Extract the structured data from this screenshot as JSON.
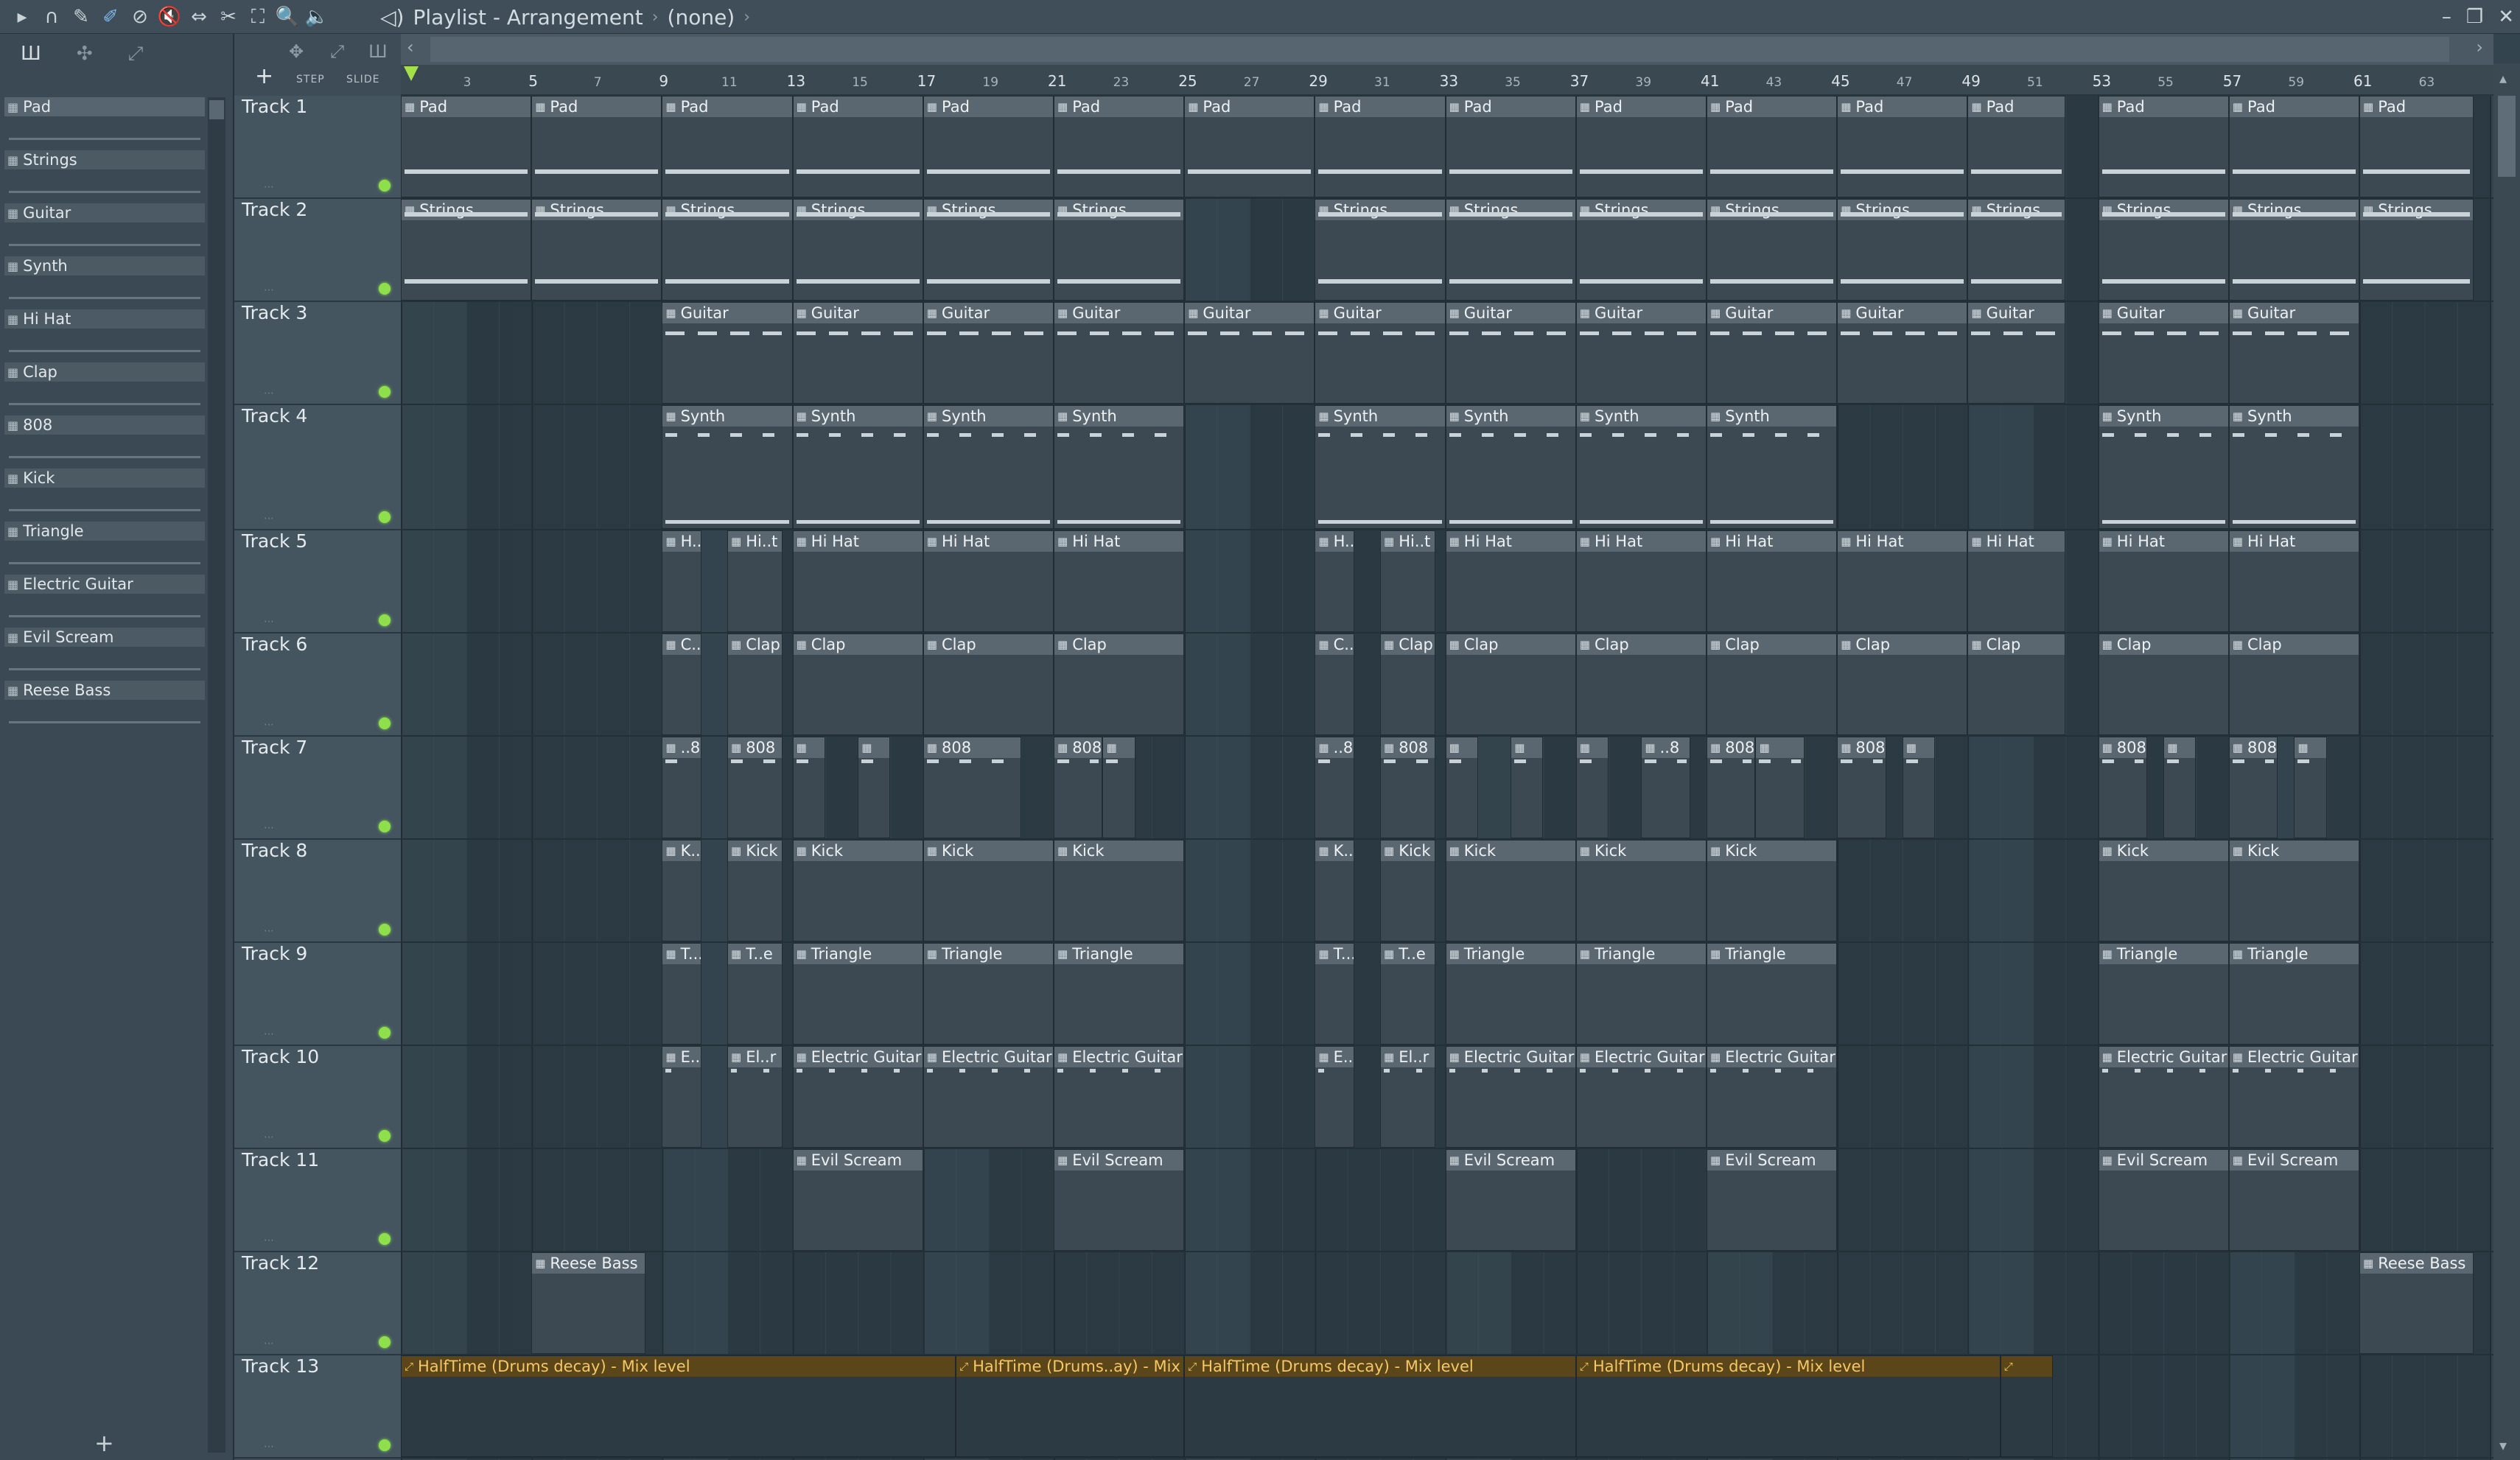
{
  "window": {
    "title": "Playlist - Arrangement",
    "subtitle": "(none)",
    "controls": [
      "–",
      "❐",
      "✕"
    ]
  },
  "toolbar": {
    "tools": [
      {
        "name": "menu-arrow-icon",
        "glyph": "▸"
      },
      {
        "name": "magnet-icon",
        "glyph": "∩"
      },
      {
        "name": "pencil-icon",
        "glyph": "✎"
      },
      {
        "name": "brush-icon",
        "glyph": "✐",
        "active": true
      },
      {
        "name": "delete-icon",
        "glyph": "⊘"
      },
      {
        "name": "mute-icon",
        "glyph": "🔇"
      },
      {
        "name": "slip-icon",
        "glyph": "⇔"
      },
      {
        "name": "slice-icon",
        "glyph": "✂"
      },
      {
        "name": "select-icon",
        "glyph": "⛶"
      },
      {
        "name": "zoom-icon",
        "glyph": "🔍"
      },
      {
        "name": "playback-icon",
        "glyph": "🔈"
      }
    ]
  },
  "panel": {
    "add_label": "+",
    "patterns": [
      "Pad",
      "Strings",
      "Guitar",
      "Synth",
      "Hi Hat",
      "Clap",
      "808",
      "Kick",
      "Triangle",
      "Electric Guitar",
      "Evil Scream",
      "Reese Bass"
    ]
  },
  "timeline": {
    "step_label": "STEP",
    "slide_label": "SLIDE",
    "add_label": "+",
    "bars": [
      "",
      "3",
      "5",
      "7",
      "9",
      "11",
      "13",
      "15",
      "17",
      "19",
      "21",
      "23",
      "25",
      "27",
      "29",
      "31",
      "33",
      "35",
      "37",
      "39",
      "41",
      "43",
      "45",
      "47",
      "49",
      "51",
      "53",
      "55",
      "57",
      "59",
      "61",
      "63"
    ]
  },
  "tracks": [
    {
      "name": "Track 1",
      "height": 140
    },
    {
      "name": "Track 2",
      "height": 140
    },
    {
      "name": "Track 3",
      "height": 140
    },
    {
      "name": "Track 4",
      "height": 170
    },
    {
      "name": "Track 5",
      "height": 140
    },
    {
      "name": "Track 6",
      "height": 140
    },
    {
      "name": "Track 7",
      "height": 140
    },
    {
      "name": "Track 8",
      "height": 140
    },
    {
      "name": "Track 9",
      "height": 140
    },
    {
      "name": "Track 10",
      "height": 140
    },
    {
      "name": "Track 11",
      "height": 140
    },
    {
      "name": "Track 12",
      "height": 140
    },
    {
      "name": "Track 13",
      "height": 140
    }
  ],
  "clips": [
    {
      "track": 0,
      "bars": [
        [
          1,
          5,
          "Pad"
        ],
        [
          5,
          9,
          "Pad"
        ],
        [
          9,
          13,
          "Pad"
        ],
        [
          13,
          17,
          "Pad"
        ],
        [
          17,
          21,
          "Pad"
        ],
        [
          21,
          25,
          "Pad"
        ],
        [
          25,
          29,
          "Pad"
        ],
        [
          29,
          33,
          "Pad"
        ],
        [
          33,
          37,
          "Pad"
        ],
        [
          37,
          41,
          "Pad"
        ],
        [
          41,
          45,
          "Pad"
        ],
        [
          45,
          49,
          "Pad"
        ],
        [
          49,
          52,
          "Pad"
        ],
        [
          53,
          57,
          "Pad"
        ],
        [
          57,
          61,
          "Pad"
        ],
        [
          61,
          64.5,
          "Pad"
        ]
      ]
    },
    {
      "track": 1,
      "bars": [
        [
          1,
          5,
          "Strings"
        ],
        [
          5,
          9,
          "Strings"
        ],
        [
          9,
          13,
          "Strings"
        ],
        [
          13,
          17,
          "Strings"
        ],
        [
          17,
          21,
          "Strings"
        ],
        [
          21,
          25,
          "Strings"
        ],
        [
          29,
          33,
          "Strings"
        ],
        [
          33,
          37,
          "Strings"
        ],
        [
          37,
          41,
          "Strings"
        ],
        [
          41,
          45,
          "Strings"
        ],
        [
          45,
          49,
          "Strings"
        ],
        [
          49,
          52,
          "Strings"
        ],
        [
          53,
          57,
          "Strings"
        ],
        [
          57,
          61,
          "Strings"
        ],
        [
          61,
          64.5,
          "Strings"
        ]
      ]
    },
    {
      "track": 2,
      "bars": [
        [
          9,
          13,
          "Guitar"
        ],
        [
          13,
          17,
          "Guitar"
        ],
        [
          17,
          21,
          "Guitar"
        ],
        [
          21,
          25,
          "Guitar"
        ],
        [
          25,
          29,
          "Guitar"
        ],
        [
          29,
          33,
          "Guitar"
        ],
        [
          33,
          37,
          "Guitar"
        ],
        [
          37,
          41,
          "Guitar"
        ],
        [
          41,
          45,
          "Guitar"
        ],
        [
          45,
          49,
          "Guitar"
        ],
        [
          49,
          52,
          "Guitar"
        ],
        [
          53,
          57,
          "Guitar"
        ],
        [
          57,
          61,
          "Guitar"
        ]
      ]
    },
    {
      "track": 3,
      "bars": [
        [
          9,
          13,
          "Synth"
        ],
        [
          13,
          17,
          "Synth"
        ],
        [
          17,
          21,
          "Synth"
        ],
        [
          21,
          25,
          "Synth"
        ],
        [
          29,
          33,
          "Synth"
        ],
        [
          33,
          37,
          "Synth"
        ],
        [
          37,
          41,
          "Synth"
        ],
        [
          41,
          45,
          "Synth"
        ],
        [
          53,
          57,
          "Synth"
        ],
        [
          57,
          61,
          "Synth"
        ]
      ]
    },
    {
      "track": 4,
      "bars": [
        [
          9,
          10.2,
          "H..."
        ],
        [
          11,
          12.7,
          "Hi..t"
        ],
        [
          13,
          17,
          "Hi Hat"
        ],
        [
          17,
          21,
          "Hi Hat"
        ],
        [
          21,
          25,
          "Hi Hat"
        ],
        [
          29,
          30.2,
          "H..."
        ],
        [
          31,
          32.7,
          "Hi..t"
        ],
        [
          33,
          37,
          "Hi Hat"
        ],
        [
          37,
          41,
          "Hi Hat"
        ],
        [
          41,
          45,
          "Hi Hat"
        ],
        [
          45,
          49,
          "Hi Hat"
        ],
        [
          49,
          52,
          "Hi Hat"
        ],
        [
          53,
          57,
          "Hi Hat"
        ],
        [
          57,
          61,
          "Hi Hat"
        ]
      ]
    },
    {
      "track": 5,
      "bars": [
        [
          9,
          10.2,
          "C..."
        ],
        [
          11,
          12.7,
          "Clap"
        ],
        [
          13,
          17,
          "Clap"
        ],
        [
          17,
          21,
          "Clap"
        ],
        [
          21,
          25,
          "Clap"
        ],
        [
          29,
          30.2,
          "C..."
        ],
        [
          31,
          32.7,
          "Clap"
        ],
        [
          33,
          37,
          "Clap"
        ],
        [
          37,
          41,
          "Clap"
        ],
        [
          41,
          45,
          "Clap"
        ],
        [
          45,
          49,
          "Clap"
        ],
        [
          49,
          52,
          "Clap"
        ],
        [
          53,
          57,
          "Clap"
        ],
        [
          57,
          61,
          "Clap"
        ]
      ]
    },
    {
      "track": 6,
      "bars": [
        [
          9,
          10.2,
          "..8"
        ],
        [
          11,
          12.7,
          "808"
        ],
        [
          13,
          14,
          ""
        ],
        [
          15,
          16,
          ""
        ],
        [
          17,
          20,
          "808"
        ],
        [
          21,
          22.5,
          "808"
        ],
        [
          22.5,
          23.5,
          ""
        ],
        [
          29,
          30.2,
          "..8"
        ],
        [
          31,
          32.7,
          "808"
        ],
        [
          33,
          34,
          ""
        ],
        [
          35,
          36,
          ""
        ],
        [
          37,
          38,
          ""
        ],
        [
          39,
          40.5,
          "..8"
        ],
        [
          41,
          42.5,
          "808"
        ],
        [
          42.5,
          44,
          ""
        ],
        [
          45,
          46.5,
          "808"
        ],
        [
          47,
          48,
          ""
        ],
        [
          53,
          54.5,
          "808"
        ],
        [
          55,
          56,
          ""
        ],
        [
          57,
          58.5,
          "808"
        ],
        [
          59,
          60,
          ""
        ]
      ]
    },
    {
      "track": 7,
      "bars": [
        [
          9,
          10.2,
          "K..."
        ],
        [
          11,
          12.7,
          "Kick"
        ],
        [
          13,
          17,
          "Kick"
        ],
        [
          17,
          21,
          "Kick"
        ],
        [
          21,
          25,
          "Kick"
        ],
        [
          29,
          30.2,
          "K..."
        ],
        [
          31,
          32.7,
          "Kick"
        ],
        [
          33,
          37,
          "Kick"
        ],
        [
          37,
          41,
          "Kick"
        ],
        [
          41,
          45,
          "Kick"
        ],
        [
          53,
          57,
          "Kick"
        ],
        [
          57,
          61,
          "Kick"
        ]
      ]
    },
    {
      "track": 8,
      "bars": [
        [
          9,
          10.2,
          "T..."
        ],
        [
          11,
          12.7,
          "T..e"
        ],
        [
          13,
          17,
          "Triangle"
        ],
        [
          17,
          21,
          "Triangle"
        ],
        [
          21,
          25,
          "Triangle"
        ],
        [
          29,
          30.2,
          "T..."
        ],
        [
          31,
          32.7,
          "T..e"
        ],
        [
          33,
          37,
          "Triangle"
        ],
        [
          37,
          41,
          "Triangle"
        ],
        [
          41,
          45,
          "Triangle"
        ],
        [
          53,
          57,
          "Triangle"
        ],
        [
          57,
          61,
          "Triangle"
        ]
      ]
    },
    {
      "track": 9,
      "bars": [
        [
          9,
          10.2,
          "E..."
        ],
        [
          11,
          12.7,
          "El..r"
        ],
        [
          13,
          17,
          "Electric Guitar"
        ],
        [
          17,
          21,
          "Electric Guitar"
        ],
        [
          21,
          25,
          "Electric Guitar"
        ],
        [
          29,
          30.2,
          "E..."
        ],
        [
          31,
          32.7,
          "El..r"
        ],
        [
          33,
          37,
          "Electric Guitar"
        ],
        [
          37,
          41,
          "Electric Guitar"
        ],
        [
          41,
          45,
          "Electric Guitar"
        ],
        [
          53,
          57,
          "Electric Guitar"
        ],
        [
          57,
          61,
          "Electric Guitar"
        ]
      ]
    },
    {
      "track": 10,
      "bars": [
        [
          13,
          17,
          "Evil Scream"
        ],
        [
          21,
          25,
          "Evil Scream"
        ],
        [
          33,
          37,
          "Evil Scream"
        ],
        [
          41,
          45,
          "Evil Scream"
        ],
        [
          53,
          57,
          "Evil Scream"
        ],
        [
          57,
          61,
          "Evil Scream"
        ]
      ]
    },
    {
      "track": 11,
      "bars": [
        [
          5,
          8.5,
          "Reese Bass"
        ],
        [
          61,
          64.5,
          "Reese Bass"
        ]
      ]
    }
  ],
  "automation": [
    [
      1,
      18,
      "HalfTime (Drums decay) - Mix level"
    ],
    [
      18,
      25,
      "HalfTime (Drums..ay) - Mix level"
    ],
    [
      25,
      37,
      "HalfTime (Drums decay) - Mix level"
    ],
    [
      37,
      50,
      "HalfTime (Drums decay) - Mix level"
    ],
    [
      50,
      51.6,
      ""
    ]
  ],
  "colors": {
    "led": "#8ee04b",
    "automation_header": "#5a4618",
    "automation_text": "#f6c764"
  }
}
